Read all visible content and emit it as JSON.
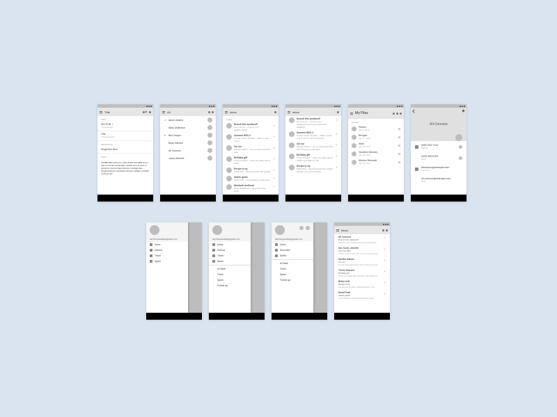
{
  "row1": {
    "s1": {
      "title": "Title",
      "sub1": "TEXT",
      "item1_pri": "SECTION 1",
      "item1_sec": "Two-line item",
      "item2_pri": "Title",
      "item2_sec": "Three-line item",
      "sub2": "SEPARATOR",
      "item3_pri": "Single-line item",
      "sub3": "BODY",
      "lorem": "UPPERLINE CAPS ALL CAPS BODY SOLDIER lorem dolor sit amet consectetur. Aptent arcu et risus in dictumst viverra magna tempor volutpat duis. Feugiat aliquam venenatis ultrices sodales convallis morbi at nec."
    },
    "s2": {
      "title": "All",
      "letters": [
        "A",
        "",
        "",
        "B",
        "",
        "",
        "",
        "J"
      ],
      "names": [
        "Aaron Adams",
        "Abby Anderson",
        "",
        "Ben Cooper",
        "Brian Hansen",
        "",
        "Ali Connors",
        "",
        "Jason Bennett"
      ]
    },
    "s3": {
      "title": "Inbox",
      "sub": "Today",
      "mails": [
        {
          "s": "Brunch this weekend?",
          "b": "Ali Connors — I'll be in your neighborhood"
        },
        {
          "s": "Summer BBQ  4",
          "b": "to Alex, Scott, Jennifer — Wish I could come"
        },
        {
          "s": "Oui oui",
          "b": "Sandra Adams — Do you have any Paris recs"
        },
        {
          "s": "Birthday gift",
          "b": "Trevor Hansen — Have any ideas about what"
        },
        {
          "s": "Recipe to try",
          "b": "Britta Holt — We should eat this: grated"
        },
        {
          "s": "Giants game",
          "b": "David Park — Any interest in seeing the"
        },
        {
          "s": "Montauk weekend",
          "b": "Scott Masterson — Here are some shots"
        }
      ]
    },
    "s4": {
      "title": "Inbox",
      "mails": [
        {
          "s": "Brunch this weekend?",
          "b": "Ali Connors — I'll be in your neighborhood doing errands this weekend"
        },
        {
          "s": "Summer BBQ  4",
          "b": "to Alex, Scott, Jennifer — Wish I could come, but I'm out of town this"
        },
        {
          "s": "Oui oui",
          "b": "Sandra Adams — Do you have any Paris recs? Have you ever been"
        },
        {
          "s": "Birthday gift",
          "b": "Trevor Hansen — Have any ideas about what to get Heidi for her"
        },
        {
          "s": "Recipe to try",
          "b": "Britta Holt — We should eat this: grated squash, corn and tomatillo"
        }
      ]
    },
    "s5": {
      "title": "My Files",
      "sub": "Folders",
      "files": [
        {
          "n": "Photos",
          "m": "Jan 9, 2014"
        },
        {
          "n": "Recipes",
          "m": "Jan 17, 2014"
        },
        {
          "n": "Work",
          "m": "Jan 28, 2014"
        },
        {
          "n": "Vacation itinerary",
          "m": "Jan 20, 2014"
        },
        {
          "n": "Kitchen Remodel",
          "m": "Jan 10, 2014"
        }
      ]
    },
    "s6": {
      "name": "Ali Connors",
      "rows": [
        {
          "p": "(650) 555-1234",
          "l": "Mobile"
        },
        {
          "p": "(323) 555-6789",
          "l": "Work"
        },
        {
          "p": "aliconnors@example.com",
          "l": "Personal"
        },
        {
          "p": "ali_connors@example.com",
          "l": "Work"
        }
      ]
    }
  },
  "row2": {
    "s1": {
      "email": "heyfromjonathan@gmail.com",
      "items": [
        {
          "i": true,
          "t": "Inbox"
        },
        {
          "i": true,
          "t": "Outbox"
        },
        {
          "i": true,
          "t": "Trash"
        },
        {
          "i": true,
          "t": "Spam"
        }
      ]
    },
    "s2": {
      "email": "heyfromjonathan@gmail.com",
      "items": [
        {
          "i": true,
          "t": "Inbox"
        },
        {
          "i": true,
          "t": "Outbox"
        },
        {
          "i": true,
          "t": "Trash"
        },
        {
          "i": true,
          "t": "Spam"
        }
      ],
      "div": true,
      "items2": [
        {
          "i": false,
          "t": "All Mail"
        },
        {
          "i": false,
          "t": "Trash"
        },
        {
          "i": false,
          "t": "Spam"
        },
        {
          "i": false,
          "t": "Follow up"
        }
      ]
    },
    "s3": {
      "email": "heyfromjonathan@gmail.com",
      "items": [
        {
          "i": true,
          "t": "Inbox"
        },
        {
          "i": true,
          "t": "Sent Mail"
        },
        {
          "i": true,
          "t": "Drafts"
        }
      ],
      "div": true,
      "items2": [
        {
          "i": false,
          "t": "All Mail"
        },
        {
          "i": false,
          "t": "Trash"
        },
        {
          "i": false,
          "t": "Spam"
        },
        {
          "i": false,
          "t": "Follow up"
        }
      ]
    },
    "s4": {
      "title": "Inbox",
      "mails": [
        {
          "f": "Ali Connors",
          "s": "Brunch this weekend?",
          "p": "I'll be in your neighborhood doing errands"
        },
        {
          "f": "me, Scott, Jennifer",
          "s": "Summer BBQ",
          "p": "Wish I could come, but I'm out of town this"
        },
        {
          "f": "Sandra Adams",
          "s": "Oui oui",
          "p": "Do you have any Paris recs? Have you ever"
        },
        {
          "f": "Trevor Hansen",
          "s": "Birthday gift",
          "p": "Have any ideas about what to get Heidi for"
        },
        {
          "f": "Britta Holt",
          "s": "Recipe to try",
          "p": "We should eat this: grated squash, corn"
        },
        {
          "f": "David Park",
          "s": "Giants game",
          "p": "Any interest in seeing the Giants game"
        }
      ]
    }
  }
}
